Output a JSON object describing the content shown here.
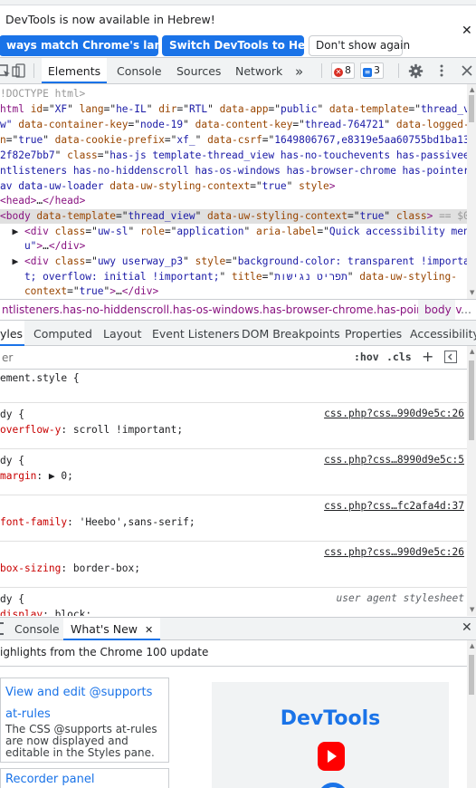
{
  "infobar": {
    "message": "DevTools is now available in Hebrew!",
    "buttons": {
      "match_language": "ways match Chrome's language",
      "switch_language": "Switch DevTools to Hebrew",
      "dont_show": "Don't show again"
    },
    "close_glyph": "✕"
  },
  "toolbar": {
    "tabs": [
      "Elements",
      "Console",
      "Sources",
      "Network"
    ],
    "active_tab": "Elements",
    "more_tabs": "»",
    "errors_count": "8",
    "issues_count": "3"
  },
  "elements_tree": {
    "lines": [
      [
        [
          "cmt",
          "!DOCTYPE html>"
        ]
      ],
      [
        [
          "tag",
          "html "
        ],
        [
          "attr",
          "id"
        ],
        [
          "pval",
          "=\""
        ],
        [
          "val",
          "XF"
        ],
        [
          "pval",
          "\" "
        ],
        [
          "attr",
          "lang"
        ],
        [
          "pval",
          "=\""
        ],
        [
          "val",
          "he-IL"
        ],
        [
          "pval",
          "\" "
        ],
        [
          "attr",
          "dir"
        ],
        [
          "pval",
          "=\""
        ],
        [
          "val",
          "RTL"
        ],
        [
          "pval",
          "\" "
        ],
        [
          "attr",
          "data-app"
        ],
        [
          "pval",
          "=\""
        ],
        [
          "val",
          "public"
        ],
        [
          "pval",
          "\" "
        ],
        [
          "attr",
          "data-template"
        ],
        [
          "pval",
          "=\""
        ],
        [
          "val",
          "thread_vi"
        ]
      ],
      [
        [
          "val",
          "w\" "
        ],
        [
          "attr",
          "data-container-key"
        ],
        [
          "pval",
          "=\""
        ],
        [
          "val",
          "node-19"
        ],
        [
          "pval",
          "\" "
        ],
        [
          "attr",
          "data-content-key"
        ],
        [
          "pval",
          "=\""
        ],
        [
          "val",
          "thread-764721"
        ],
        [
          "pval",
          "\" "
        ],
        [
          "attr",
          "data-logged-"
        ]
      ],
      [
        [
          "attr",
          "n"
        ],
        [
          "pval",
          "=\""
        ],
        [
          "val",
          "true"
        ],
        [
          "pval",
          "\" "
        ],
        [
          "attr",
          "data-cookie-prefix"
        ],
        [
          "pval",
          "=\""
        ],
        [
          "val",
          "xf_"
        ],
        [
          "pval",
          "\" "
        ],
        [
          "attr",
          "data-csrf"
        ],
        [
          "pval",
          "=\""
        ],
        [
          "val",
          "1649806767,e8319e5aa60755bd1ba13e"
        ]
      ],
      [
        [
          "val",
          "2f82e7bb7"
        ],
        [
          "pval",
          "\" "
        ],
        [
          "attr",
          "class"
        ],
        [
          "pval",
          "=\""
        ],
        [
          "val",
          "has-js template-thread_view has-no-touchevents has-passiveev"
        ]
      ],
      [
        [
          "val",
          "ntlisteners has-no-hiddenscroll has-os-windows has-browser-chrome has-pointer-"
        ]
      ],
      [
        [
          "val",
          "av data-uw-loader"
        ],
        [
          "pval",
          " "
        ],
        [
          "attr",
          "data-uw-styling-context"
        ],
        [
          "pval",
          "=\""
        ],
        [
          "val",
          "true"
        ],
        [
          "pval",
          "\" "
        ],
        [
          "attr",
          "style"
        ],
        [
          "tag",
          ">"
        ]
      ],
      [
        [
          "tag",
          "<head>"
        ],
        [
          "pval",
          "…"
        ],
        [
          "tag",
          "</head>"
        ]
      ],
      [
        [
          "tag",
          "<body "
        ],
        [
          "attr",
          "data-template"
        ],
        [
          "pval",
          "=\""
        ],
        [
          "val",
          "thread_view"
        ],
        [
          "pval",
          "\" "
        ],
        [
          "attr",
          "data-uw-styling-context"
        ],
        [
          "pval",
          "=\""
        ],
        [
          "val",
          "true"
        ],
        [
          "pval",
          "\" "
        ],
        [
          "attr",
          "class"
        ],
        [
          "tag",
          ">"
        ],
        [
          "cmt",
          " == $0"
        ]
      ],
      [
        [
          "pval",
          "  ▶ "
        ],
        [
          "tag",
          "<div "
        ],
        [
          "attr",
          "class"
        ],
        [
          "pval",
          "=\""
        ],
        [
          "val",
          "uw-sl"
        ],
        [
          "pval",
          "\" "
        ],
        [
          "attr",
          "role"
        ],
        [
          "pval",
          "=\""
        ],
        [
          "val",
          "application"
        ],
        [
          "pval",
          "\" "
        ],
        [
          "attr",
          "aria-label"
        ],
        [
          "pval",
          "=\""
        ],
        [
          "val",
          "Quick accessibility men"
        ]
      ],
      [
        [
          "val",
          "    u\""
        ],
        [
          "tag",
          ">"
        ],
        [
          "pval",
          "…"
        ],
        [
          "tag",
          "</div>"
        ]
      ],
      [
        [
          "pval",
          "  ▶ "
        ],
        [
          "tag",
          "<div "
        ],
        [
          "attr",
          "class"
        ],
        [
          "pval",
          "=\""
        ],
        [
          "val",
          "uwy userway_p3"
        ],
        [
          "pval",
          "\" "
        ],
        [
          "attr",
          "style"
        ],
        [
          "pval",
          "=\""
        ],
        [
          "val",
          "background-color: transparent !importan"
        ]
      ],
      [
        [
          "val",
          "    t; overflow: initial !important;"
        ],
        [
          "pval",
          "\" "
        ],
        [
          "attr",
          "title"
        ],
        [
          "pval",
          "=\""
        ],
        [
          "val",
          "תפריט נגישות"
        ],
        [
          "pval",
          "\" "
        ],
        [
          "attr",
          "data-uw-styling-"
        ]
      ],
      [
        [
          "attr",
          "    context"
        ],
        [
          "pval",
          "=\""
        ],
        [
          "val",
          "true"
        ],
        [
          "pval",
          "\""
        ],
        [
          "tag",
          ">"
        ],
        [
          "pval",
          "…"
        ],
        [
          "tag",
          "</div>"
        ]
      ]
    ]
  },
  "breadcrumb": {
    "path": "ntlisteners.has-no-hiddenscroll.has-os-windows.has-browser-chrome.has-pointer-nav",
    "body": "body",
    "ellipsis": "…"
  },
  "styles_tabs": {
    "tabs": [
      "yles",
      "Computed",
      "Layout",
      "Event Listeners",
      "DOM Breakpoints",
      "Properties",
      "Accessibility"
    ],
    "active_tab": "yles"
  },
  "filter": {
    "placeholder": "er",
    "hov": ":hov",
    "cls": ".cls",
    "add": "+"
  },
  "style_rules": [
    {
      "selector": "ement.style {",
      "source": "",
      "decls": [],
      "closing": ""
    },
    {
      "selector": "dy {",
      "source": "css.php?css…990d9e5c:26",
      "decls": [
        [
          "overflow-y",
          "scroll !important"
        ]
      ],
      "closing": ""
    },
    {
      "selector": "dy {",
      "source": "css.php?css…8990d9e5c:5",
      "decls": [
        [
          "margin",
          "▶ 0"
        ]
      ],
      "closing": ""
    },
    {
      "selector": "",
      "source": "css.php?css…fc2afa4d:37",
      "decls": [
        [
          "font-family",
          "'Heebo',sans-serif"
        ]
      ],
      "closing": ""
    },
    {
      "selector": "",
      "source": "css.php?css…990d9e5c:26",
      "decls": [
        [
          "box-sizing",
          "border-box"
        ]
      ],
      "closing": ""
    },
    {
      "selector": "dy {",
      "source": "user agent stylesheet",
      "decls": [
        [
          "display",
          "block"
        ]
      ],
      "closing": ""
    }
  ],
  "drawer": {
    "tabs": [
      "Console",
      "What's New"
    ],
    "active_tab": "What's New",
    "close_glyph": "✕",
    "heading": "ighlights from the Chrome 100 update",
    "cards": [
      {
        "title": "View and edit @supports at-rules",
        "body": "The CSS @supports at-rules are now displayed and editable in the Styles pane."
      },
      {
        "title": "Recorder panel",
        "body": ""
      }
    ],
    "promo_title": "DevTools"
  }
}
